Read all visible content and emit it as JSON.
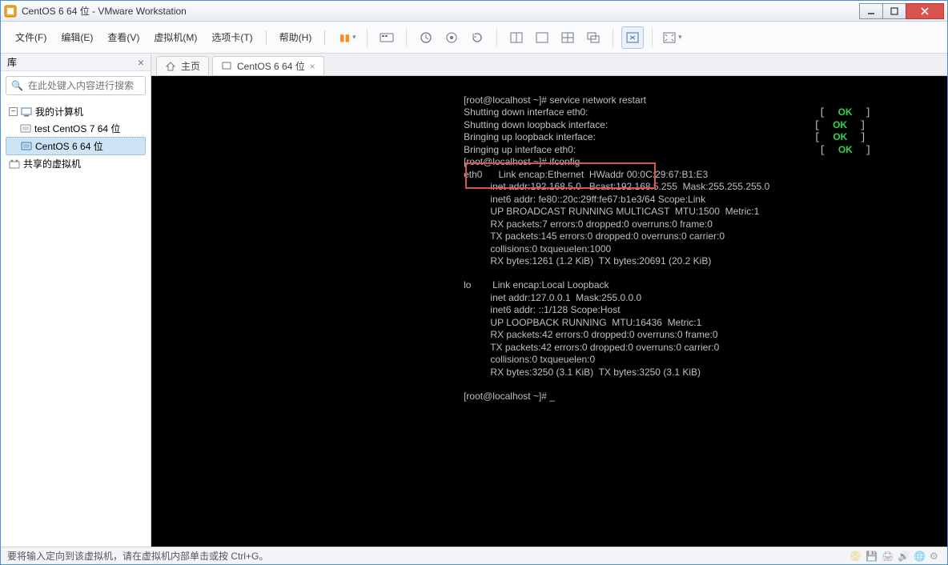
{
  "window": {
    "title": "CentOS 6 64 位 - VMware Workstation"
  },
  "menu": {
    "file": "文件(F)",
    "edit": "编辑(E)",
    "view": "查看(V)",
    "vm": "虚拟机(M)",
    "tabs": "选项卡(T)",
    "help": "帮助(H)"
  },
  "sidebar": {
    "header": "库",
    "search_placeholder": "在此处键入内容进行搜索",
    "root": "我的计算机",
    "node_test": "test CentOS 7 64 位",
    "node_centos6": "CentOS 6 64 位",
    "shared": "共享的虚拟机"
  },
  "tabs": {
    "home": "主页",
    "centos": "CentOS 6 64 位"
  },
  "terminal": {
    "prompt1": "[root@localhost ~]# service network restart",
    "shutdown_eth0": "Shutting down interface eth0:",
    "shutdown_lo": "Shutting down loopback interface:",
    "bring_lo": "Bringing up loopback interface:",
    "bring_eth0": "Bringing up interface eth0:",
    "ok": "OK",
    "prompt2": "[root@localhost ~]# ifconfig",
    "eth0_l1": "eth0      Link encap:Ethernet  HWaddr 00:0C:29:67:B1:E3",
    "eth0_l2": "          inet addr:192.168.5.0   Bcast:192.168.5.255  Mask:255.255.255.0",
    "eth0_l3": "          inet6 addr: fe80::20c:29ff:fe67:b1e3/64 Scope:Link",
    "eth0_l4": "          UP BROADCAST RUNNING MULTICAST  MTU:1500  Metric:1",
    "eth0_l5": "          RX packets:7 errors:0 dropped:0 overruns:0 frame:0",
    "eth0_l6": "          TX packets:145 errors:0 dropped:0 overruns:0 carrier:0",
    "eth0_l7": "          collisions:0 txqueuelen:1000",
    "eth0_l8": "          RX bytes:1261 (1.2 KiB)  TX bytes:20691 (20.2 KiB)",
    "lo_l1": "lo        Link encap:Local Loopback",
    "lo_l2": "          inet addr:127.0.0.1  Mask:255.0.0.0",
    "lo_l3": "          inet6 addr: ::1/128 Scope:Host",
    "lo_l4": "          UP LOOPBACK RUNNING  MTU:16436  Metric:1",
    "lo_l5": "          RX packets:42 errors:0 dropped:0 overruns:0 frame:0",
    "lo_l6": "          TX packets:42 errors:0 dropped:0 overruns:0 carrier:0",
    "lo_l7": "          collisions:0 txqueuelen:0",
    "lo_l8": "          RX bytes:3250 (3.1 KiB)  TX bytes:3250 (3.1 KiB)",
    "prompt3": "[root@localhost ~]# _"
  },
  "status": {
    "hint": "要将输入定向到该虚拟机，请在虚拟机内部单击或按 Ctrl+G。"
  }
}
